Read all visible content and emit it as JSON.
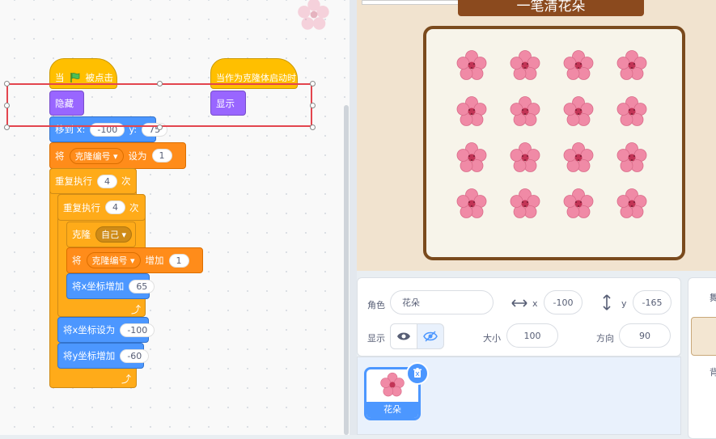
{
  "code": {
    "hat_flag": {
      "prefix": "当",
      "suffix": "被点击"
    },
    "hat_clone": {
      "label": "当作为克隆体启动时"
    },
    "hide": {
      "label": "隐藏"
    },
    "show": {
      "label": "显示"
    },
    "goto": {
      "label": "移到 x:",
      "x": "-100",
      "ylabel": "y:",
      "y": "75"
    },
    "set_var": {
      "prefix": "将",
      "var": "克隆编号",
      "mid": "设为",
      "value": "1"
    },
    "repeat_outer": {
      "label": "重复执行",
      "count": "4",
      "suffix": "次"
    },
    "repeat_inner": {
      "label": "重复执行",
      "count": "4",
      "suffix": "次"
    },
    "clone": {
      "label": "克隆",
      "target": "自己"
    },
    "change_var": {
      "prefix": "将",
      "var": "克隆编号",
      "mid": "增加",
      "value": "1"
    },
    "change_x": {
      "label": "将x坐标增加",
      "value": "65"
    },
    "set_x": {
      "label": "将x坐标设为",
      "value": "-100"
    },
    "change_y": {
      "label": "将y坐标增加",
      "value": "-60"
    }
  },
  "stage": {
    "title": "一笔清花朵",
    "icon": "cherry-blossom-icon",
    "grid_rows": 4,
    "grid_cols": 4
  },
  "sprite_info": {
    "sprite_label": "角色",
    "sprite_name": "花朵",
    "x_label": "x",
    "x_value": "-100",
    "y_label": "y",
    "y_value": "-165",
    "show_label": "显示",
    "size_label": "大小",
    "size_value": "100",
    "direction_label": "方向",
    "direction_value": "90"
  },
  "sprite_list": {
    "tile_name": "花朵",
    "delete_icon": "trash-icon"
  },
  "stage_pane": {
    "tab_label": "舞",
    "background_label": "背"
  },
  "colors": {
    "events": "#ffbf00",
    "looks": "#9966ff",
    "motion": "#4c97ff",
    "variables": "#ff8c1a",
    "control": "#ffab19",
    "selection": "#e3454e",
    "board_frame": "#7a4a1d",
    "title_bar": "#8b4a1e"
  }
}
